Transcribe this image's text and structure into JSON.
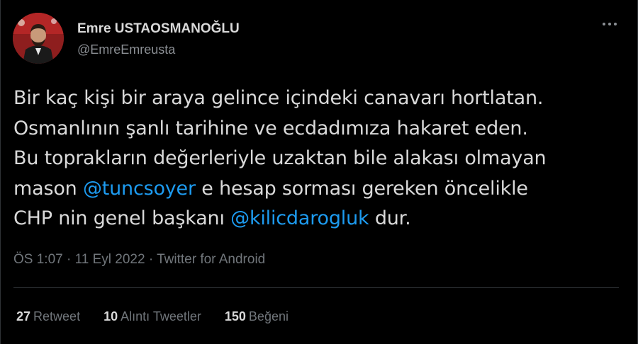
{
  "author": {
    "name": "Emre USTAOSMANOĞLU",
    "handle": "@EmreEmreusta"
  },
  "tweet": {
    "lines": [
      [
        {
          "text": "Bir kaç kişi bir araya gelince içindeki canavarı hortlatan."
        }
      ],
      [
        {
          "text": "Osmanlının şanlı tarihine ve ecdadımıza hakaret eden."
        }
      ],
      [
        {
          "text": "Bu toprakların değerleriyle uzaktan bile alakası olmayan"
        }
      ],
      [
        {
          "text": "mason "
        },
        {
          "text": "@tuncsoyer",
          "mention": true
        },
        {
          "text": " e hesap sorması gereken öncelikle"
        }
      ],
      [
        {
          "text": "CHP nin genel başkanı "
        },
        {
          "text": "@kilicdarogluk",
          "mention": true
        },
        {
          "text": " dur."
        }
      ]
    ]
  },
  "meta": {
    "time": "ÖS 1:07",
    "separator": "·",
    "date": "11 Eyl 2022",
    "source": "Twitter for Android"
  },
  "stats": {
    "retweets": {
      "count": "27",
      "label": "Retweet"
    },
    "quotes": {
      "count": "10",
      "label": "Alıntı Tweetler"
    },
    "likes": {
      "count": "150",
      "label": "Beğeni"
    }
  },
  "colors": {
    "background": "#000000",
    "text": "#d9d9d9",
    "secondary": "#71767b",
    "mention": "#1d9bf0",
    "divider": "#2f3336"
  },
  "icons": {
    "more": "more-horizontal-icon"
  }
}
